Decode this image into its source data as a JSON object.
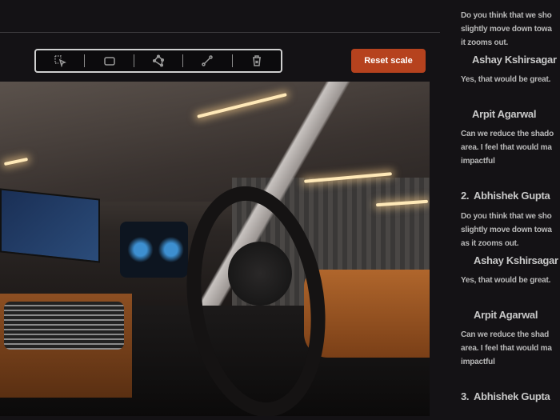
{
  "toolbar": {
    "tools": [
      {
        "icon": "select-icon"
      },
      {
        "icon": "rectangle-icon"
      },
      {
        "icon": "polygon-icon"
      },
      {
        "icon": "line-icon"
      },
      {
        "icon": "trash-icon"
      }
    ],
    "reset_label": "Reset scale",
    "reset_color": "#b6421e"
  },
  "comments": [
    {
      "lines": [
        "Do you think that we sho",
        "slightly move down towa",
        "it zooms out."
      ]
    },
    {
      "name": "Ashay Kshirsagar",
      "lines": [
        "Yes, that would be great."
      ]
    },
    {
      "name": "Arpit Agarwal",
      "lines": [
        "Can we reduce the shado",
        "area. I feel that would ma",
        "impactful"
      ]
    },
    {
      "number": "2.",
      "name": "Abhishek Gupta",
      "lines": [
        "Do you think that we sho",
        "slightly move down towa",
        "as it zooms out."
      ]
    },
    {
      "name": "Ashay Kshirsagar",
      "lines": [
        "Yes, that would be great."
      ]
    },
    {
      "name": "Arpit Agarwal",
      "lines": [
        "Can we reduce the shad",
        "area. I feel that would ma",
        "impactful"
      ]
    },
    {
      "number": "3.",
      "name": "Abhishek Gupta"
    }
  ]
}
